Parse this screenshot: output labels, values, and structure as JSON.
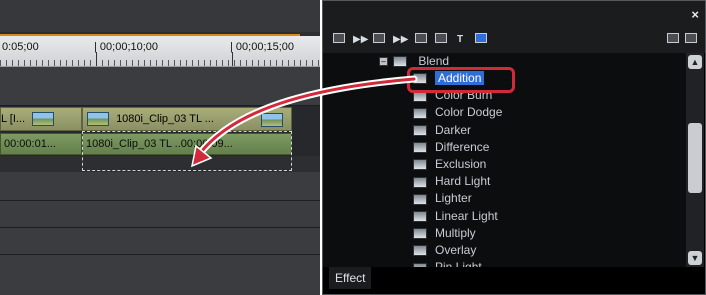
{
  "timeline": {
    "ruler": [
      "0:05;00",
      "| 00;00;10;00",
      "| 00;00;15;00"
    ],
    "video_clips": [
      {
        "label": "L [I..."
      },
      {
        "label": "1080i_Clip_03  TL  ..."
      }
    ],
    "audio_clips": [
      {
        "label": "00:00:01..."
      },
      {
        "label": "1080i_Clip_03  TL  ..00:00:09..."
      }
    ]
  },
  "panel": {
    "close": "×",
    "toolbar_text_tool": "T",
    "tree": {
      "folder": "Blend",
      "items": [
        {
          "label": "Addition",
          "selected": true
        },
        {
          "label": "Color Burn"
        },
        {
          "label": "Color Dodge"
        },
        {
          "label": "Darker"
        },
        {
          "label": "Difference"
        },
        {
          "label": "Exclusion"
        },
        {
          "label": "Hard Light"
        },
        {
          "label": "Lighter"
        },
        {
          "label": "Linear Light"
        },
        {
          "label": "Multiply"
        },
        {
          "label": "Overlay"
        },
        {
          "label": "Pin Light"
        }
      ]
    },
    "tab": "Effect"
  },
  "colors": {
    "selection": "#2f6ed8",
    "annotation": "#d22a3a"
  }
}
